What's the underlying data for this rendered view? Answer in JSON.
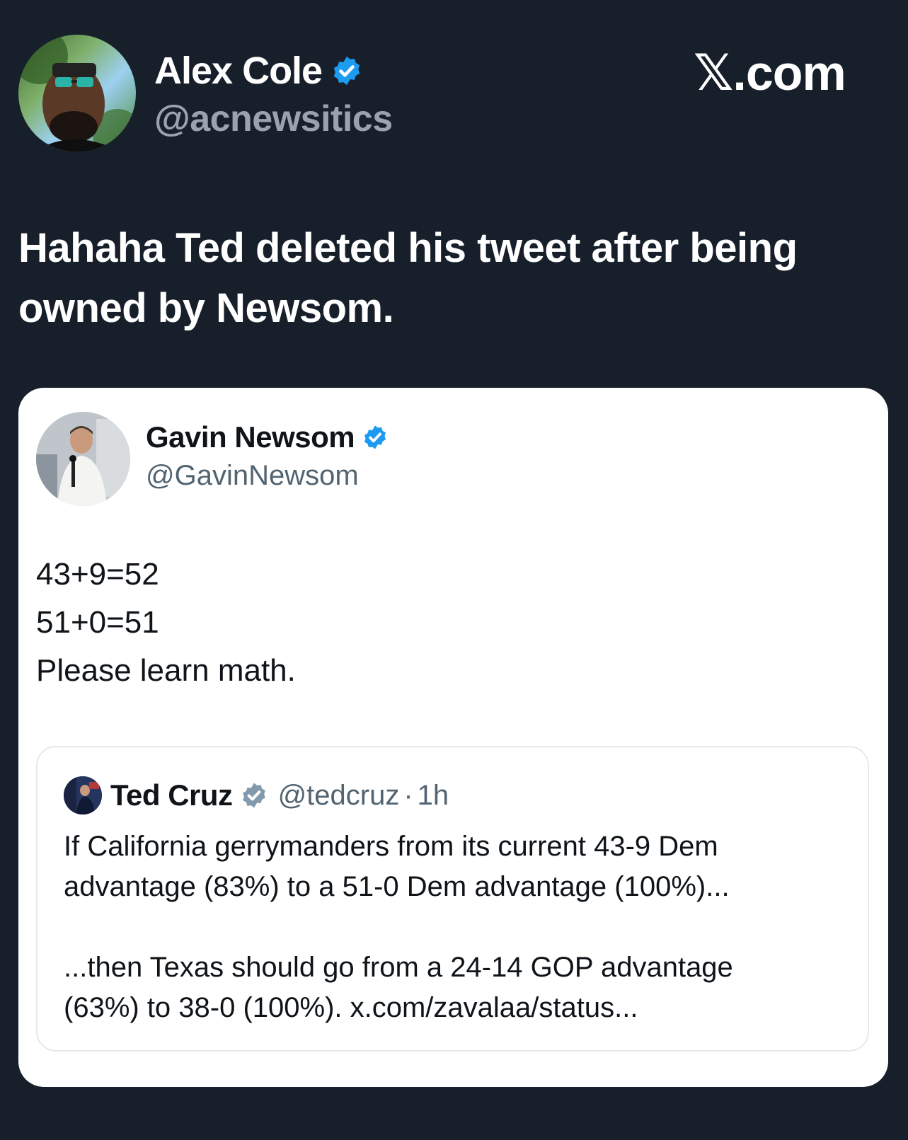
{
  "post": {
    "author_name": "Alex Cole",
    "author_handle": "@acnewsitics",
    "brand": "𝕏.com",
    "text": "Hahaha Ted deleted his tweet after being owned by Newsom."
  },
  "embedded": {
    "author_name": "Gavin Newsom",
    "author_handle": "@GavinNewsom",
    "lines": [
      "43+9=52",
      "51+0=51",
      "Please learn math."
    ],
    "quote": {
      "author_name": "Ted Cruz",
      "author_handle": "@tedcruz",
      "separator": "·",
      "time": "1h",
      "paragraph_1_line_1": "If California gerrymanders from its current 43-9 Dem",
      "paragraph_1_line_2": "advantage (83%) to a 51-0 Dem advantage (100%)...",
      "paragraph_2_line_1": "...then Texas should go from  a 24-14 GOP advantage",
      "paragraph_2_line_2": "(63%) to 38-0 (100%). x.com/zavalaa/status..."
    }
  },
  "colors": {
    "background": "#17202a",
    "verified_blue": "#1d9bf0",
    "verified_gray": "#829aab",
    "card": "#ffffff"
  },
  "icons": {
    "verified": "verified-badge-icon",
    "verified_gray": "verified-gray-badge-icon"
  }
}
